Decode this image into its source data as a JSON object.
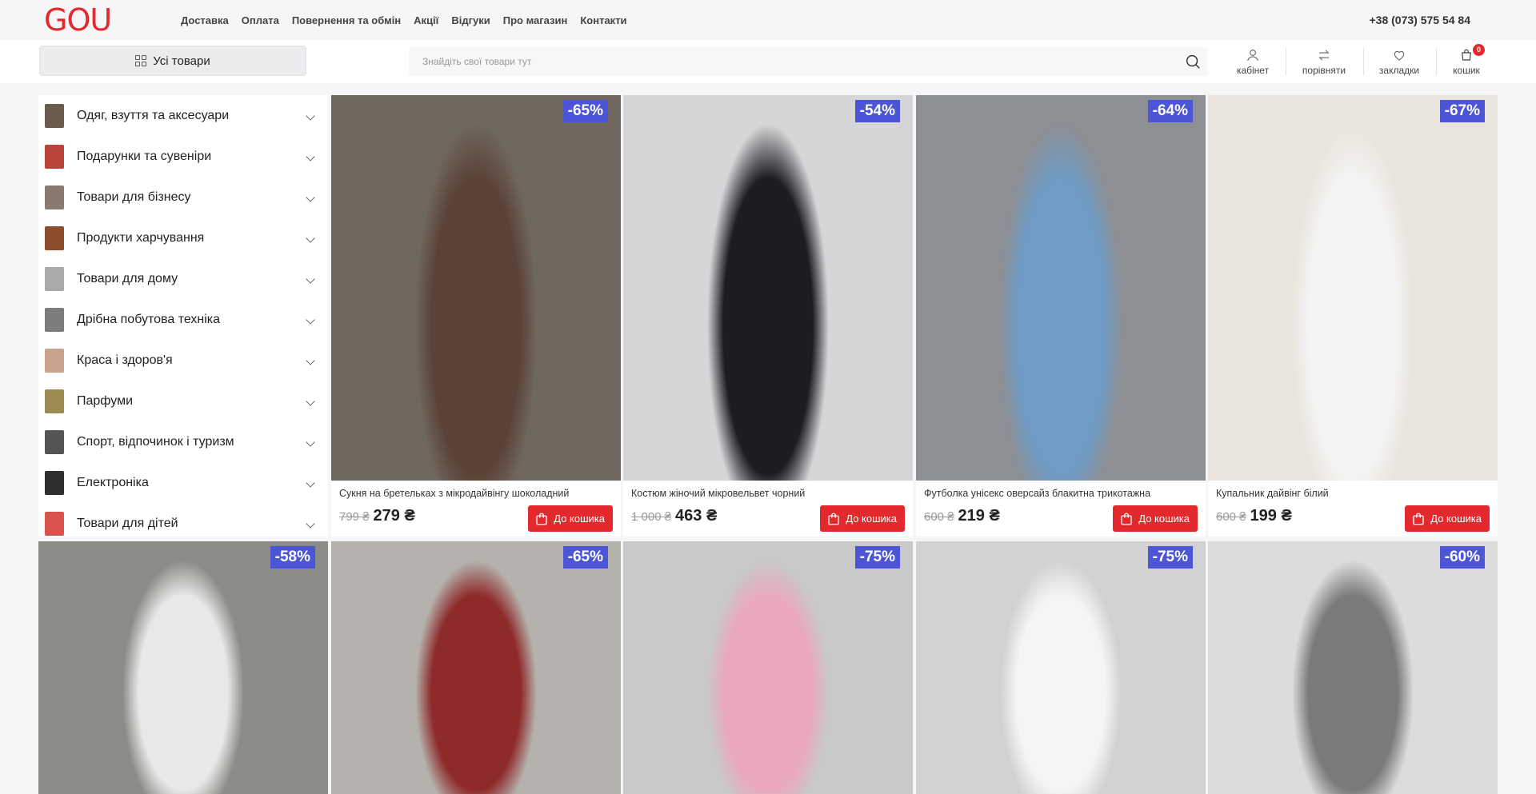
{
  "logo": "GOU",
  "nav": [
    "Доставка",
    "Оплата",
    "Повернення та обмін",
    "Акції",
    "Відгуки",
    "Про магазин",
    "Контакти"
  ],
  "phone": "+38 (073) 575 54 84",
  "all_products_label": "Усі товари",
  "search": {
    "placeholder": "Знайдіть свої товари тут",
    "value": ""
  },
  "user_actions": [
    {
      "label": "кабінет",
      "icon": "user-icon"
    },
    {
      "label": "порівняти",
      "icon": "compare-arrows-icon"
    },
    {
      "label": "закладки",
      "icon": "heart-icon"
    },
    {
      "label": "кошик",
      "icon": "cart-icon"
    }
  ],
  "cart_count": "0",
  "categories": [
    {
      "label": "Одяг, взуття та аксесуари",
      "thumb_color": "#6b5b4d"
    },
    {
      "label": "Подарунки та сувеніри",
      "thumb_color": "#b8443a"
    },
    {
      "label": "Товари для бізнесу",
      "thumb_color": "#8a7a6e"
    },
    {
      "label": "Продукти харчування",
      "thumb_color": "#8a4e2c"
    },
    {
      "label": "Товари для дому",
      "thumb_color": "#a9a9a9"
    },
    {
      "label": "Дрібна побутова техніка",
      "thumb_color": "#7d7d7d"
    },
    {
      "label": "Краса і здоров'я",
      "thumb_color": "#c9a38b"
    },
    {
      "label": "Парфуми",
      "thumb_color": "#9b8a52"
    },
    {
      "label": "Спорт, відпочинок і туризм",
      "thumb_color": "#555555"
    },
    {
      "label": "Електроніка",
      "thumb_color": "#2e2e2e"
    },
    {
      "label": "Товари для дітей",
      "thumb_color": "#d9534f"
    }
  ],
  "cart_button_label": "До кошика",
  "products": [
    {
      "name": "Сукня на бретельках з мікродайвінгу шоколадний",
      "old_price": "799 ₴",
      "price": "279 ₴",
      "discount": "-65%",
      "colors": [
        "#6f665e",
        "#5a4336"
      ]
    },
    {
      "name": "Костюм жіночий мікровельвет чорний",
      "old_price": "1 000 ₴",
      "price": "463 ₴",
      "discount": "-54%",
      "colors": [
        "#d6d6d8",
        "#1c1c22"
      ]
    },
    {
      "name": "Футболка унісекс оверсайз блакитна трикотажна",
      "old_price": "600 ₴",
      "price": "219 ₴",
      "discount": "-64%",
      "colors": [
        "#8c8f94",
        "#6f9bc4"
      ]
    },
    {
      "name": "Купальник дайвінг білий",
      "old_price": "600 ₴",
      "price": "199 ₴",
      "discount": "-67%",
      "colors": [
        "#e9e4dc",
        "#f4f4f4"
      ]
    },
    {
      "discount": "-58%",
      "colors": [
        "#8b8b87",
        "#e8e8e8"
      ]
    },
    {
      "discount": "-65%",
      "colors": [
        "#b5b2ad",
        "#8e2a2a"
      ]
    },
    {
      "discount": "-75%",
      "colors": [
        "#c9c9c9",
        "#e9a8bf"
      ]
    },
    {
      "discount": "-75%",
      "colors": [
        "#d1d1d1",
        "#f5f5f5"
      ]
    },
    {
      "discount": "-60%",
      "colors": [
        "#dcdcdc",
        "#7a7a7a"
      ]
    }
  ]
}
